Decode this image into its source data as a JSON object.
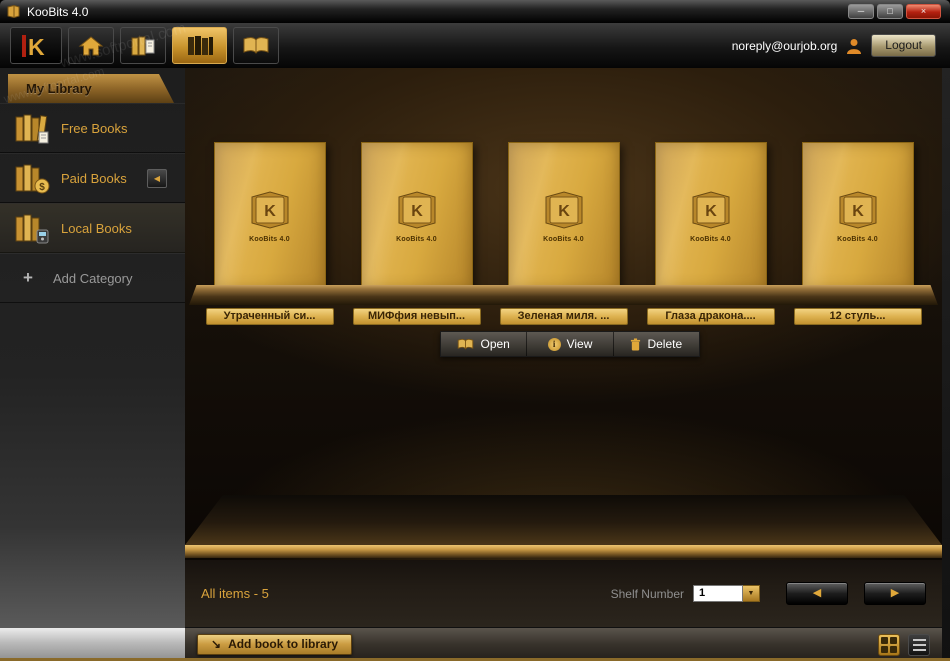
{
  "window": {
    "title": "KooBits 4.0"
  },
  "icons": {
    "minimize": "─",
    "maximize": "□",
    "close": "×",
    "dropdown": "▼",
    "prev": "◀",
    "next": "▶",
    "collapse": "◀",
    "plus": "+",
    "add_arrow": "↘"
  },
  "watermark": "www.softportal.com",
  "toolbar": {
    "email": "noreply@ourjob.org",
    "logout": "Logout"
  },
  "sidebar": {
    "header": "My Library",
    "items": [
      {
        "label": "Free Books"
      },
      {
        "label": "Paid Books"
      },
      {
        "label": "Local Books"
      },
      {
        "label": "Add Category"
      }
    ]
  },
  "shelf": {
    "cover_label": "KooBits 4.0",
    "books": [
      {
        "title": "Утраченный си..."
      },
      {
        "title": "МИФфия невып..."
      },
      {
        "title": "Зеленая миля. ..."
      },
      {
        "title": "Глаза дракона...."
      },
      {
        "title": "12 стуль..."
      }
    ],
    "context_menu": {
      "open": "Open",
      "view": "View",
      "delete": "Delete"
    }
  },
  "statusbar": {
    "all_items": "All items - 5",
    "shelf_number_label": "Shelf Number",
    "shelf_number_value": "1"
  },
  "bottombar": {
    "add_book": "Add book to library"
  }
}
